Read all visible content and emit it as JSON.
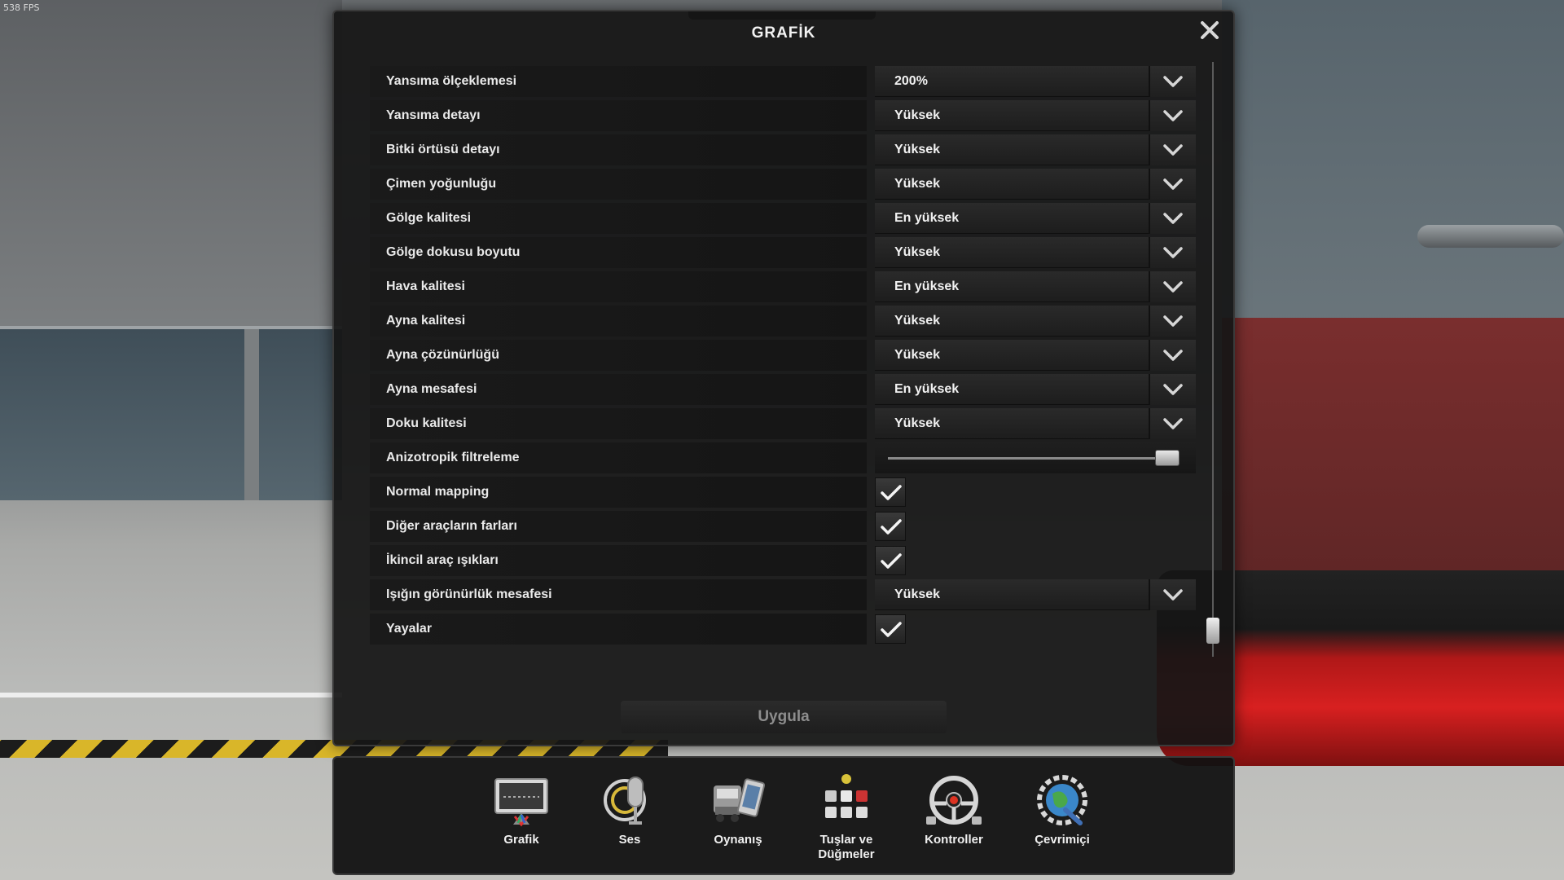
{
  "fps": "538 FPS",
  "dialog": {
    "title": "GRAFİK",
    "close_icon": "close-icon",
    "apply_label": "Uygula"
  },
  "settings": [
    {
      "label": "Yansıma ölçeklemesi",
      "type": "select",
      "value": "200%"
    },
    {
      "label": "Yansıma detayı",
      "type": "select",
      "value": "Yüksek"
    },
    {
      "label": "Bitki örtüsü detayı",
      "type": "select",
      "value": "Yüksek"
    },
    {
      "label": "Çimen yoğunluğu",
      "type": "select",
      "value": "Yüksek"
    },
    {
      "label": "Gölge kalitesi",
      "type": "select",
      "value": "En yüksek"
    },
    {
      "label": "Gölge dokusu boyutu",
      "type": "select",
      "value": "Yüksek"
    },
    {
      "label": "Hava kalitesi",
      "type": "select",
      "value": "En yüksek"
    },
    {
      "label": "Ayna kalitesi",
      "type": "select",
      "value": "Yüksek"
    },
    {
      "label": "Ayna çözünürlüğü",
      "type": "select",
      "value": "Yüksek"
    },
    {
      "label": "Ayna mesafesi",
      "type": "select",
      "value": "En yüksek"
    },
    {
      "label": "Doku kalitesi",
      "type": "select",
      "value": "Yüksek"
    },
    {
      "label": "Anizotropik filtreleme",
      "type": "slider",
      "value": 1.0
    },
    {
      "label": "Normal mapping",
      "type": "checkbox",
      "value": true
    },
    {
      "label": "Diğer araçların farları",
      "type": "checkbox",
      "value": true
    },
    {
      "label": "İkincil araç ışıkları",
      "type": "checkbox",
      "value": true
    },
    {
      "label": "Işığın görünürlük mesafesi",
      "type": "select",
      "value": "Yüksek"
    },
    {
      "label": "Yayalar",
      "type": "checkbox",
      "value": true
    }
  ],
  "nav": [
    {
      "label": "Grafik",
      "icon": "monitor-icon"
    },
    {
      "label": "Ses",
      "icon": "microphone-icon"
    },
    {
      "label": "Oynanış",
      "icon": "truck-phone-icon"
    },
    {
      "label": "Tuşlar ve Düğmeler",
      "icon": "keys-icon"
    },
    {
      "label": "Kontroller",
      "icon": "steering-wheel-icon"
    },
    {
      "label": "Çevrimiçi",
      "icon": "globe-gear-icon"
    }
  ]
}
